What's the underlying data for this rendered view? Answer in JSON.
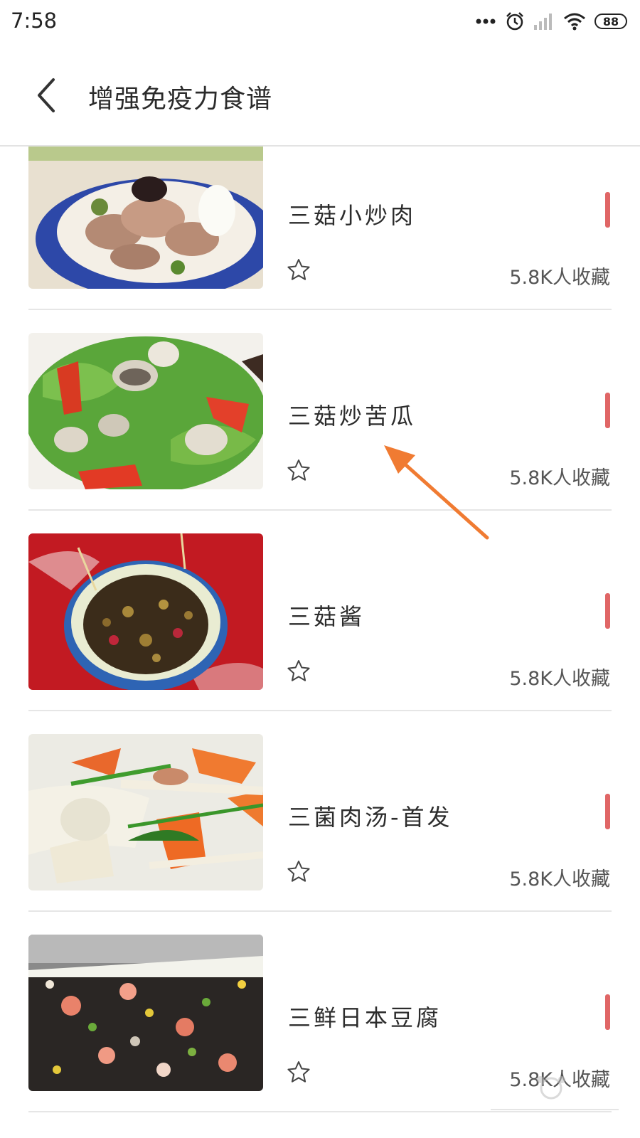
{
  "status_bar": {
    "time": "7:58",
    "battery": "88"
  },
  "header": {
    "title": "增强免疫力食谱"
  },
  "recipes": [
    {
      "name": "三菇小炒肉",
      "favorites": "5.8K人收藏"
    },
    {
      "name": "三菇炒苦瓜",
      "favorites": "5.8K人收藏"
    },
    {
      "name": "三菇酱",
      "favorites": "5.8K人收藏"
    },
    {
      "name": "三菌肉汤-首发",
      "favorites": "5.8K人收藏"
    },
    {
      "name": "三鲜日本豆腐",
      "favorites": "5.8K人收藏"
    }
  ],
  "colors": {
    "accent_bar": "#e06666",
    "annotation_arrow": "#f07b32"
  },
  "icons": {
    "back": "chevron-left-icon",
    "favorite": "star-outline-icon"
  }
}
